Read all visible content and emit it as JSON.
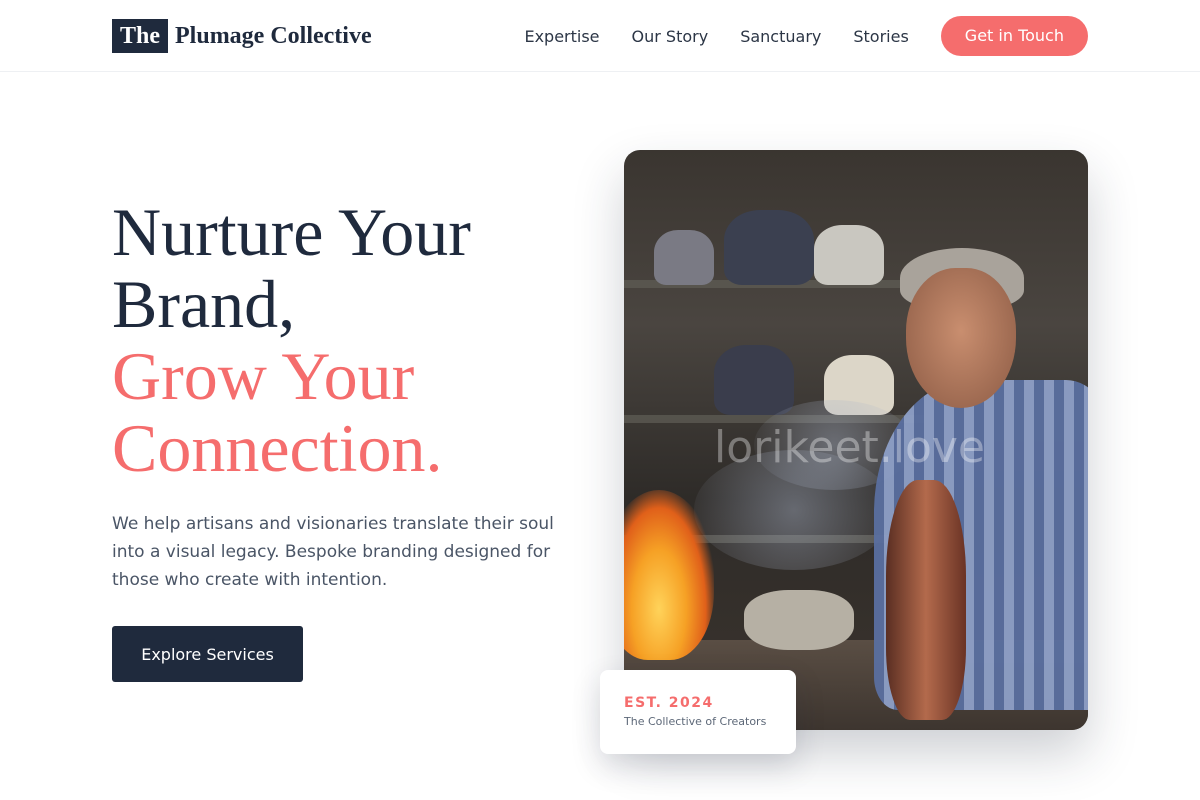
{
  "header": {
    "logo_mark": "The",
    "logo_text": "Plumage Collective",
    "nav": [
      "Expertise",
      "Our Story",
      "Sanctuary",
      "Stories"
    ],
    "cta_label": "Get in Touch"
  },
  "hero": {
    "title_line1": "Nurture Your",
    "title_line2": "Brand,",
    "title_line3": "Grow Your",
    "title_line4": "Connection.",
    "description": "We help artisans and visionaries translate their soul into a visual legacy. Bespoke branding designed for those who create with intention.",
    "button_label": "Explore Services"
  },
  "image": {
    "watermark": "lorikeet.love"
  },
  "badge": {
    "title": "EST. 2024",
    "subtitle": "The Collective of Creators"
  },
  "colors": {
    "navy": "#1f2a3d",
    "coral": "#f56d6d",
    "text_muted": "#4a5566"
  }
}
